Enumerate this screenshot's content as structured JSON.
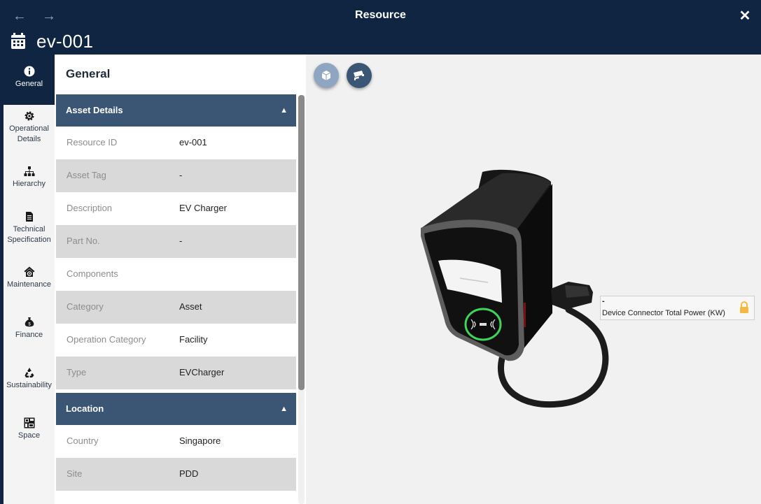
{
  "header": {
    "title": "Resource",
    "resource_name": "ev-001",
    "back_label": "←",
    "forward_label": "→",
    "close_label": "✕"
  },
  "sidebar": {
    "items": [
      {
        "label": "General"
      },
      {
        "label": "Operational Details"
      },
      {
        "label": "Hierarchy"
      },
      {
        "label": "Technical Specification"
      },
      {
        "label": "Maintenance"
      },
      {
        "label": "Finance"
      },
      {
        "label": "Sustainability"
      },
      {
        "label": "Space"
      }
    ]
  },
  "panel": {
    "title": "General",
    "asset_section": {
      "heading": "Asset Details",
      "rows": [
        {
          "label": "Resource ID",
          "value": "ev-001"
        },
        {
          "label": "Asset Tag",
          "value": "-"
        },
        {
          "label": "Description",
          "value": "EV Charger"
        },
        {
          "label": "Part No.",
          "value": "-"
        },
        {
          "label": "Components",
          "value": ""
        },
        {
          "label": "Category",
          "value": "Asset"
        },
        {
          "label": "Operation Category",
          "value": "Facility"
        },
        {
          "label": "Type",
          "value": "EVCharger"
        }
      ]
    },
    "location_section": {
      "heading": "Location",
      "rows": [
        {
          "label": "Country",
          "value": "Singapore"
        },
        {
          "label": "Site",
          "value": "PDD"
        }
      ]
    }
  },
  "viewer": {
    "tooltip_dash": "-",
    "tooltip_text": "Device Connector Total Power (KW)",
    "colors": {
      "ring": "#3fd45a",
      "lock": "#f4b942",
      "header": "#0f2541",
      "section": "#3b5575"
    }
  }
}
